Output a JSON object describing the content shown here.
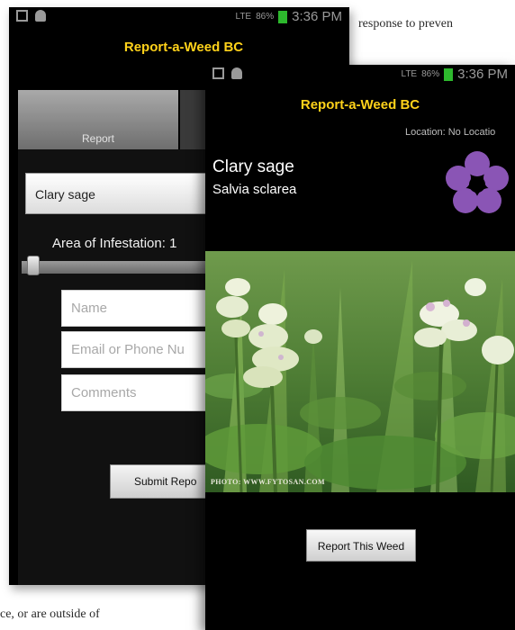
{
  "page_text": {
    "top_fragment": "response to preven",
    "bottom_fragment": "ce, or are outside of"
  },
  "status_bar": {
    "signal_text": "LTE",
    "battery_text": "86%",
    "time": "3:36 PM",
    "battery_color": "#2db82d"
  },
  "app": {
    "title": "Report-a-Weed BC",
    "title_color": "#ffd21a"
  },
  "report_screen": {
    "tab_report": "Report",
    "weed_select_value": "Clary sage",
    "area_label": "Area of Infestation: 1",
    "name_placeholder": "Name",
    "contact_placeholder": "Email or Phone Nu",
    "comments_placeholder": "Comments",
    "submit_label": "Submit Repo"
  },
  "weed_screen": {
    "location": "Location: No Locatio",
    "common_name": "Clary sage",
    "scientific_name": "Salvia sclarea",
    "flower_icon": "flower-icon",
    "flower_color": "#8a55b5",
    "photo_credit": "PHOTO: WWW.FYTOSAN.COM",
    "report_button": "Report This Weed"
  }
}
